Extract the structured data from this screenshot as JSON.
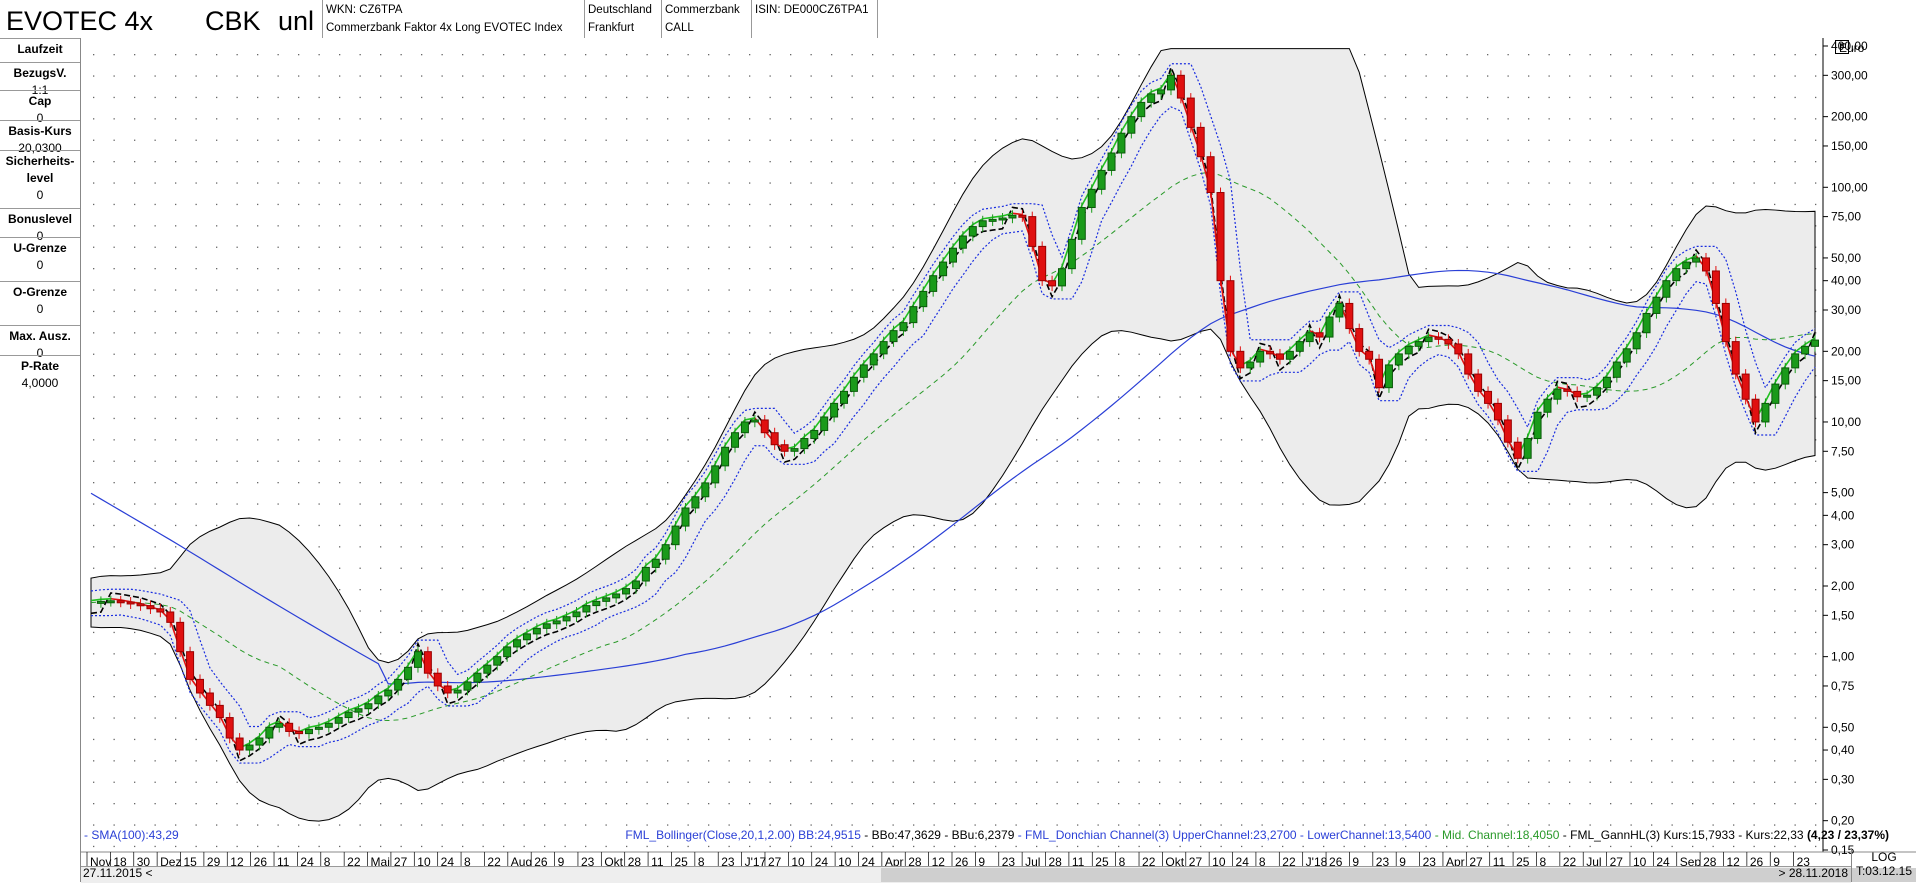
{
  "header": {
    "title": "EVOTEC 4x",
    "issuer_short": "CBK",
    "suffix": "unl",
    "wkn": "WKN: CZ6TPA",
    "product_name": "Commerzbank Faktor 4x Long EVOTEC Index",
    "country": "Deutschland",
    "exchange": "Frankfurt",
    "issuer": "Commerzbank",
    "type": "CALL",
    "isin": "ISIN: DE000CZ6TPA1"
  },
  "sidebar": [
    {
      "label": "Laufzeit",
      "value": ""
    },
    {
      "label": "BezugsV.",
      "value": "1:1"
    },
    {
      "label": "Cap",
      "value": "0"
    },
    {
      "label": "Basis-Kurs",
      "value": "20,0300"
    },
    {
      "label": "Sicherheits-",
      "label2": "level",
      "value": "0"
    },
    {
      "label": "Bonuslevel",
      "value": "0"
    },
    {
      "label": "U-Grenze",
      "value": "0"
    },
    {
      "label": "O-Grenze",
      "value": "0"
    },
    {
      "label": "Max. Ausz.",
      "value": "0"
    },
    {
      "label": "P-Rate",
      "value": "4,0000"
    }
  ],
  "legend": {
    "sma": "- SMA(100):43,29",
    "bollinger": "FML_Bollinger(Close,20,1,2.00) BB:24,9515",
    "bbo": "- BBo:47,3629",
    "bbu": "- BBu:6,2379",
    "donchian": "- FML_Donchian Channel(3) UpperChannel:23,2700",
    "lower": "- LowerChannel:13,5400",
    "mid": "- Mid. Channel:18,4050",
    "gann": "- FML_GannHL(3) Kurs:15,7933",
    "kurs": "- Kurs:22,33",
    "change": "(4,23 / 23,37%)"
  },
  "footer": {
    "start_date": "27.11.2015",
    "end_date": "> 28.11.2018",
    "scale_mode": "LOG",
    "t_date": "T:03.12.15",
    "nav_left": "<"
  },
  "colors": {
    "sma": "#2a3fd6",
    "bollinger_fill": "#ececec",
    "bollinger_line": "#000000",
    "donchian": "#1a2ee0",
    "mid": "#2a9a2a",
    "gann": "#000000",
    "ema_red": "#e01010",
    "ema_green": "#20c020",
    "candle_up": "#1a9a1a",
    "candle_down": "#e01010"
  },
  "chart_data": {
    "type": "candlestick",
    "unit": "Euro",
    "scale": "log",
    "ylim": [
      0.15,
      400
    ],
    "y_ticks": [
      "400,00",
      "300,00",
      "200,00",
      "150,00",
      "100,00",
      "75,00",
      "50,00",
      "40,00",
      "30,00",
      "20,00",
      "15,00",
      "10,00",
      "7,50",
      "5,00",
      "4,00",
      "3,00",
      "2,00",
      "1,50",
      "1,00",
      "0,75",
      "0,50",
      "0,40",
      "0,30",
      "0,20",
      "0,15"
    ],
    "y_tick_values": [
      400,
      300,
      200,
      150,
      100,
      75,
      50,
      40,
      30,
      20,
      15,
      10,
      7.5,
      5,
      4,
      3,
      2,
      1.5,
      1,
      0.75,
      0.5,
      0.4,
      0.3,
      0.2,
      0.15
    ],
    "x_labels": [
      "Nov",
      "18",
      "30",
      "Dez",
      "15",
      "29",
      "12",
      "26",
      "11",
      "24",
      "8",
      "22",
      "Mai",
      "27",
      "10",
      "24",
      "8",
      "22",
      "Aug",
      "26",
      "9",
      "23",
      "Okt",
      "28",
      "11",
      "25",
      "8",
      "23",
      "J'17",
      "27",
      "10",
      "24",
      "10",
      "24",
      "Apr",
      "28",
      "12",
      "26",
      "9",
      "23",
      "Jul",
      "28",
      "11",
      "25",
      "8",
      "22",
      "Okt",
      "27",
      "10",
      "24",
      "8",
      "22",
      "J'18",
      "26",
      "9",
      "23",
      "9",
      "23",
      "Apr",
      "27",
      "11",
      "25",
      "8",
      "22",
      "Jul",
      "27",
      "10",
      "24",
      "Sep",
      "28",
      "12",
      "26",
      "9",
      "23"
    ],
    "series": [
      {
        "name": "Kurs",
        "values": [
          1.7,
          1.72,
          1.73,
          1.71,
          1.68,
          1.65,
          1.6,
          1.55,
          1.4,
          1.05,
          0.8,
          0.7,
          0.62,
          0.55,
          0.45,
          0.4,
          0.42,
          0.45,
          0.5,
          0.52,
          0.48,
          0.47,
          0.49,
          0.5,
          0.52,
          0.55,
          0.58,
          0.6,
          0.63,
          0.68,
          0.72,
          0.8,
          0.9,
          1.05,
          0.85,
          0.75,
          0.7,
          0.72,
          0.78,
          0.85,
          0.92,
          1.0,
          1.1,
          1.18,
          1.25,
          1.32,
          1.38,
          1.42,
          1.48,
          1.55,
          1.65,
          1.72,
          1.78,
          1.85,
          1.95,
          2.1,
          2.4,
          2.6,
          3.0,
          3.6,
          4.3,
          4.8,
          5.5,
          6.5,
          7.8,
          9.0,
          10.0,
          10.2,
          9.0,
          8.0,
          7.5,
          7.7,
          8.5,
          9.2,
          10.5,
          12.0,
          13.5,
          15.5,
          17.5,
          19.5,
          22.0,
          24.5,
          26.5,
          31.0,
          36.0,
          42.0,
          48.0,
          55.0,
          62.0,
          68.0,
          72.0,
          73.0,
          74.0,
          76.0,
          75.0,
          56.0,
          40.0,
          38.0,
          45.0,
          60.0,
          82.0,
          98.0,
          118.0,
          140.0,
          170.0,
          200.0,
          230.0,
          250.0,
          260.0,
          300.0,
          240.0,
          180.0,
          135.0,
          95.0,
          40.0,
          20.0,
          17.0,
          18.0,
          20.0,
          19.5,
          18.5,
          20.0,
          22.0,
          24.0,
          23.0,
          28.0,
          32.0,
          25.0,
          20.0,
          18.5,
          14.0,
          17.5,
          19.5,
          21.0,
          22.0,
          23.0,
          22.5,
          21.5,
          19.5,
          16.0,
          13.5,
          12.0,
          10.2,
          8.2,
          7.0,
          8.5,
          11.0,
          12.5,
          13.8,
          13.5,
          12.8,
          13.0,
          14.0,
          15.5,
          18.0,
          20.5,
          24.0,
          29.0,
          34.0,
          40.0,
          45.0,
          48.0,
          50.0,
          44.0,
          32.0,
          22.0,
          16.0,
          12.5,
          10.0,
          12.0,
          14.5,
          17.0,
          19.5,
          21.0,
          22.33
        ]
      }
    ]
  }
}
